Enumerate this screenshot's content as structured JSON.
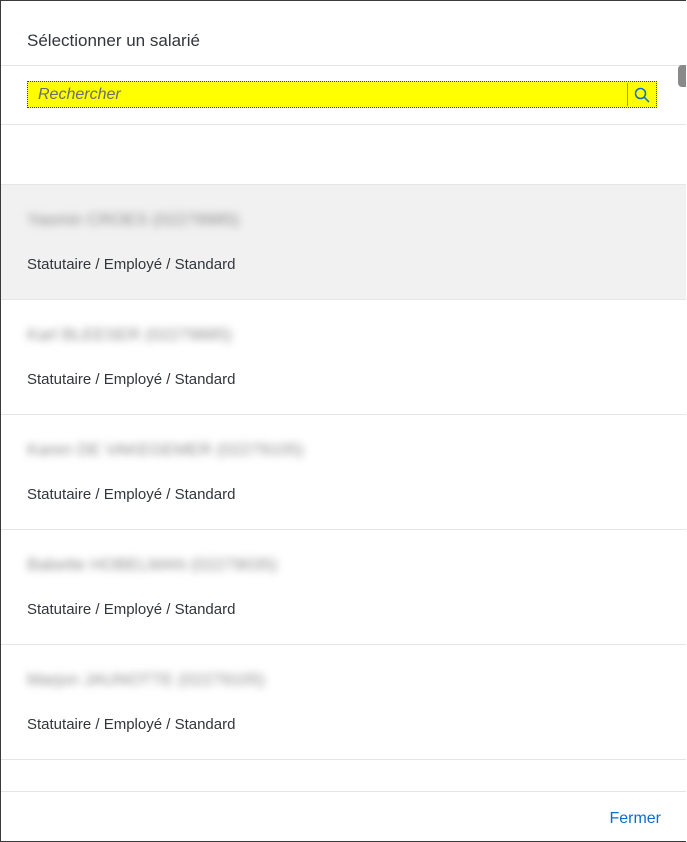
{
  "dialog": {
    "title": "Sélectionner un salarié"
  },
  "search": {
    "placeholder": "Rechercher",
    "value": ""
  },
  "employees": [
    {
      "name": "Yasmin CROES (02279985)",
      "description": "Statutaire / Employé / Standard"
    },
    {
      "name": "Karl BLEESER (02279885)",
      "description": "Statutaire / Employé / Standard"
    },
    {
      "name": "Karen DE VAKEGEMER (02279105)",
      "description": "Statutaire / Employé / Standard"
    },
    {
      "name": "Babette HOBELMAN (02279035)",
      "description": "Statutaire / Employé / Standard"
    },
    {
      "name": "Marjon JAUNOTTE (02279105)",
      "description": "Statutaire / Employé / Standard"
    }
  ],
  "footer": {
    "close_label": "Fermer"
  },
  "colors": {
    "accent": "#0a6ed1",
    "search_highlight": "#ffff00",
    "selected_row": "#f1f1f1"
  }
}
